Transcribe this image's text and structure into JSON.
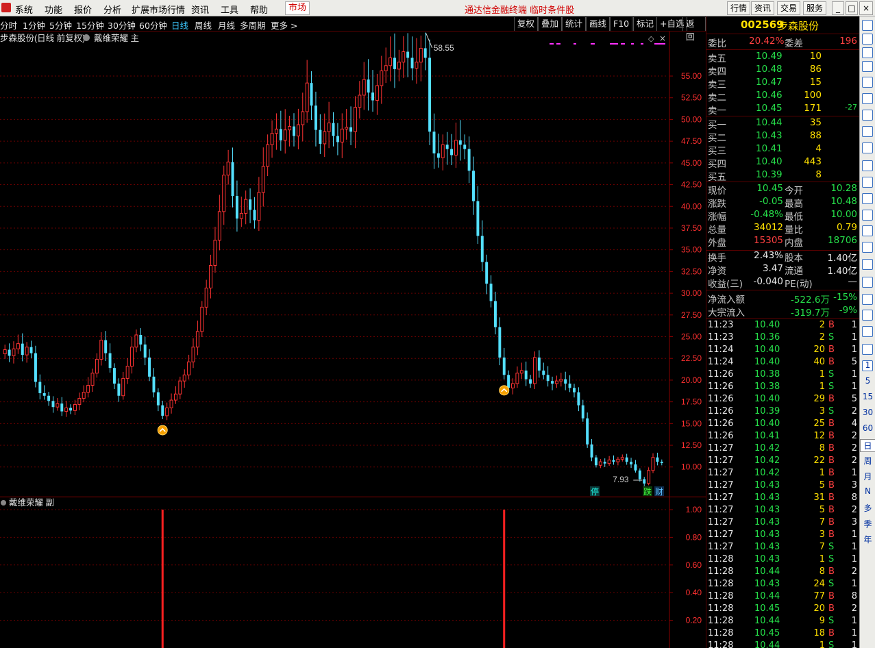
{
  "menu": {
    "items": [
      "系统",
      "功能",
      "报价",
      "分析",
      "扩展市场行情",
      "资讯",
      "工具",
      "帮助"
    ],
    "market": "市场",
    "center_text": "通达信金融终端 临时条件股",
    "right_buttons": [
      "行情",
      "资讯",
      "交易",
      "服务"
    ]
  },
  "periods": {
    "items": [
      "分时",
      "1分钟",
      "5分钟",
      "15分钟",
      "30分钟",
      "60分钟",
      "日线",
      "周线",
      "月线",
      "多周期",
      "更多 >"
    ],
    "active": "日线",
    "tools": [
      "复权",
      "叠加",
      "统计",
      "画线",
      "F10",
      "标记",
      "+自选",
      "返回"
    ]
  },
  "chart_info": {
    "title": "步森股份(日线 前复权)",
    "indicator": "戴维荣耀 主",
    "sub_indicator": "戴维荣耀 副",
    "max_label": "58.55",
    "min_label": "7.93",
    "badges": [
      "停",
      "跌",
      "财"
    ]
  },
  "quote": {
    "code": "002569",
    "name": "步森股份",
    "weibi_label": "委比",
    "weibi": "20.42%",
    "weicha_label": "委差",
    "weicha": "196",
    "asks": [
      {
        "label": "卖五",
        "price": "10.49",
        "vol": "10",
        "chg": ""
      },
      {
        "label": "卖四",
        "price": "10.48",
        "vol": "86",
        "chg": ""
      },
      {
        "label": "卖三",
        "price": "10.47",
        "vol": "15",
        "chg": ""
      },
      {
        "label": "卖二",
        "price": "10.46",
        "vol": "100",
        "chg": ""
      },
      {
        "label": "卖一",
        "price": "10.45",
        "vol": "171",
        "chg": "-27"
      }
    ],
    "bids": [
      {
        "label": "买一",
        "price": "10.44",
        "vol": "35"
      },
      {
        "label": "买二",
        "price": "10.43",
        "vol": "88"
      },
      {
        "label": "买三",
        "price": "10.41",
        "vol": "4"
      },
      {
        "label": "买四",
        "price": "10.40",
        "vol": "443"
      },
      {
        "label": "买五",
        "price": "10.39",
        "vol": "8"
      }
    ],
    "stats": [
      {
        "l1": "现价",
        "v1": "10.45",
        "c1": "green",
        "l2": "今开",
        "v2": "10.28",
        "c2": "green"
      },
      {
        "l1": "涨跌",
        "v1": "-0.05",
        "c1": "green",
        "l2": "最高",
        "v2": "10.48",
        "c2": "green"
      },
      {
        "l1": "涨幅",
        "v1": "-0.48%",
        "c1": "green",
        "l2": "最低",
        "v2": "10.00",
        "c2": "green"
      },
      {
        "l1": "总量",
        "v1": "34012",
        "c1": "yellow",
        "l2": "量比",
        "v2": "0.79",
        "c2": "yellow"
      },
      {
        "l1": "外盘",
        "v1": "15305",
        "c1": "red",
        "l2": "内盘",
        "v2": "18706",
        "c2": "green"
      }
    ],
    "fund": [
      {
        "l1": "换手",
        "v1": "2.43%",
        "l2": "股本",
        "v2": "1.40亿"
      },
      {
        "l1": "净资",
        "v1": "3.47",
        "l2": "流通",
        "v2": "1.40亿"
      },
      {
        "l1": "收益(三)",
        "v1": "-0.040",
        "l2": "PE(动)",
        "v2": "—"
      }
    ],
    "flow": [
      {
        "label": "净流入额",
        "v1": "-522.6万",
        "v2": "-15%"
      },
      {
        "label": "大宗流入",
        "v1": "-319.7万",
        "v2": "-9%"
      }
    ]
  },
  "ticks": [
    {
      "t": "11:23",
      "p": "10.40",
      "v": "2",
      "s": "B",
      "n": "1"
    },
    {
      "t": "11:23",
      "p": "10.36",
      "v": "2",
      "s": "S",
      "n": "1"
    },
    {
      "t": "11:24",
      "p": "10.40",
      "v": "20",
      "s": "B",
      "n": "1"
    },
    {
      "t": "11:24",
      "p": "10.40",
      "v": "40",
      "s": "B",
      "n": "5"
    },
    {
      "t": "11:26",
      "p": "10.38",
      "v": "1",
      "s": "S",
      "n": "1"
    },
    {
      "t": "11:26",
      "p": "10.38",
      "v": "1",
      "s": "S",
      "n": "1"
    },
    {
      "t": "11:26",
      "p": "10.40",
      "v": "29",
      "s": "B",
      "n": "5"
    },
    {
      "t": "11:26",
      "p": "10.39",
      "v": "3",
      "s": "S",
      "n": "2"
    },
    {
      "t": "11:26",
      "p": "10.40",
      "v": "25",
      "s": "B",
      "n": "4"
    },
    {
      "t": "11:26",
      "p": "10.41",
      "v": "12",
      "s": "B",
      "n": "2"
    },
    {
      "t": "11:27",
      "p": "10.42",
      "v": "8",
      "s": "B",
      "n": "2"
    },
    {
      "t": "11:27",
      "p": "10.42",
      "v": "22",
      "s": "B",
      "n": "2"
    },
    {
      "t": "11:27",
      "p": "10.42",
      "v": "1",
      "s": "B",
      "n": "1"
    },
    {
      "t": "11:27",
      "p": "10.43",
      "v": "5",
      "s": "B",
      "n": "3"
    },
    {
      "t": "11:27",
      "p": "10.43",
      "v": "31",
      "s": "B",
      "n": "8"
    },
    {
      "t": "11:27",
      "p": "10.43",
      "v": "5",
      "s": "B",
      "n": "2"
    },
    {
      "t": "11:27",
      "p": "10.43",
      "v": "7",
      "s": "B",
      "n": "3"
    },
    {
      "t": "11:27",
      "p": "10.43",
      "v": "3",
      "s": "B",
      "n": "1"
    },
    {
      "t": "11:27",
      "p": "10.43",
      "v": "7",
      "s": "S",
      "n": "1"
    },
    {
      "t": "11:28",
      "p": "10.43",
      "v": "1",
      "s": "S",
      "n": "1"
    },
    {
      "t": "11:28",
      "p": "10.44",
      "v": "8",
      "s": "B",
      "n": "2"
    },
    {
      "t": "11:28",
      "p": "10.43",
      "v": "24",
      "s": "S",
      "n": "1"
    },
    {
      "t": "11:28",
      "p": "10.44",
      "v": "77",
      "s": "B",
      "n": "8"
    },
    {
      "t": "11:28",
      "p": "10.45",
      "v": "20",
      "s": "B",
      "n": "2"
    },
    {
      "t": "11:28",
      "p": "10.44",
      "v": "9",
      "s": "S",
      "n": "1"
    },
    {
      "t": "11:28",
      "p": "10.45",
      "v": "18",
      "s": "B",
      "n": "1"
    },
    {
      "t": "11:28",
      "p": "10.44",
      "v": "1",
      "s": "S",
      "n": "1"
    }
  ],
  "toolstrip_periods": [
    "1",
    "5",
    "15",
    "30",
    "60",
    "日",
    "周",
    "月",
    "N",
    "多",
    "季",
    "年"
  ],
  "toolstrip_active": "日",
  "chart_data": {
    "type": "candlestick",
    "y_ticks": [
      55.0,
      52.5,
      50.0,
      47.5,
      45.0,
      42.5,
      40.0,
      37.5,
      35.0,
      32.5,
      30.0,
      27.5,
      25.0,
      22.5,
      20.0,
      17.5,
      15.0,
      12.5,
      10.0
    ],
    "ylim": [
      7.93,
      58.55
    ],
    "max": 58.55,
    "min": 7.93,
    "close_path": [
      23.5,
      22.8,
      23.6,
      24.2,
      22.9,
      23.8,
      23.1,
      19.8,
      18.5,
      18.2,
      17.6,
      16.9,
      17.3,
      16.4,
      16.8,
      16.5,
      17.2,
      17.9,
      18.6,
      19.4,
      20.8,
      22.4,
      24.6,
      23.1,
      21.4,
      19.6,
      18.2,
      20.2,
      21.6,
      23.8,
      25.2,
      24.1,
      22.6,
      20.4,
      18.6,
      17.1,
      15.9,
      16.8,
      17.7,
      18.4,
      19.9,
      20.6,
      22.1,
      23.8,
      25.6,
      28.4,
      30.6,
      33.2,
      36.1,
      39.4,
      43.6,
      45.1,
      41.2,
      38.6,
      39.2,
      40.8,
      39.6,
      38.4,
      41.6,
      44.6,
      47.1,
      48.4,
      48.9,
      47.6,
      48.8,
      49.2,
      48.1,
      49.4,
      50.9,
      54.2,
      51.6,
      48.8,
      47.2,
      48.6,
      49.6,
      48.1,
      47.4,
      48.9,
      49.1,
      48.6,
      51.4,
      52.8,
      54.6,
      53.1,
      52.2,
      53.9,
      55.6,
      56.2,
      57.1,
      55.8,
      56.6,
      57.8,
      57.1,
      55.9,
      56.6,
      58.2,
      57.1,
      48.6,
      46.1,
      45.6,
      47.1,
      46.6,
      45.9,
      47.6,
      47.1,
      46.6,
      44.1,
      40.6,
      36.6,
      33.6,
      31.1,
      29.1,
      26.1,
      22.6,
      20.6,
      19.1,
      19.6,
      20.8,
      21.1,
      20.1,
      19.6,
      22.6,
      21.1,
      20.6,
      19.9,
      19.6,
      19.9,
      20.1,
      19.6,
      19.1,
      18.6,
      17.1,
      15.6,
      12.6,
      11.1,
      10.2,
      10.6,
      10.4,
      10.8,
      10.6,
      10.9,
      11.1,
      10.6,
      10.3,
      9.6,
      8.6,
      8.1,
      9.6,
      11.1,
      10.6,
      10.45
    ],
    "signals": [
      {
        "series": "main",
        "type": "buy-arrow",
        "index": 36
      },
      {
        "series": "main",
        "type": "buy-arrow",
        "index": 114
      }
    ],
    "sub_series": {
      "name": "戴维荣耀 副",
      "y_ticks": [
        1.0,
        0.8,
        0.6,
        0.4,
        0.2
      ],
      "ylim": [
        0,
        1
      ],
      "spikes_at_index": [
        36,
        114
      ],
      "spike_value": 1.0
    }
  }
}
